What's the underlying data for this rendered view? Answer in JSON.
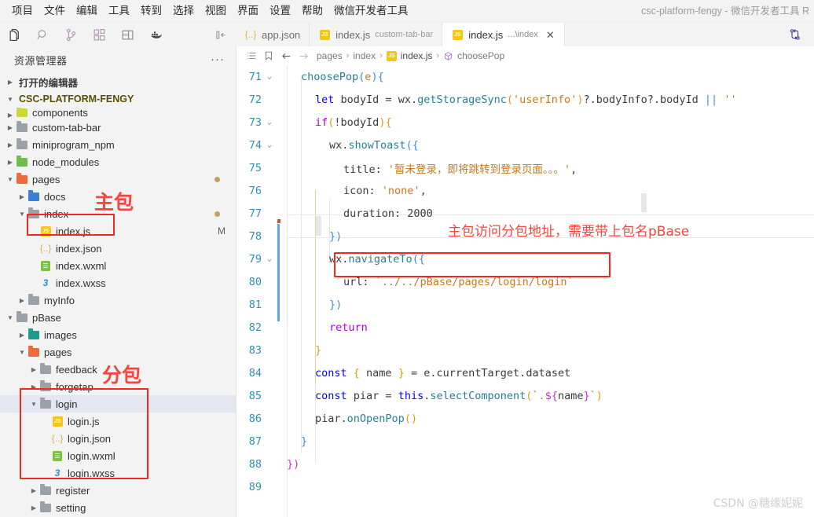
{
  "window": {
    "title": "csc-platform-fengy - 微信开发者工具 R",
    "menus": [
      "项目",
      "文件",
      "编辑",
      "工具",
      "转到",
      "选择",
      "视图",
      "界面",
      "设置",
      "帮助",
      "微信开发者工具"
    ]
  },
  "activity_bar": {
    "items": [
      {
        "name": "explorer-icon",
        "label": "资源管理器"
      },
      {
        "name": "search-icon",
        "label": "搜索"
      },
      {
        "name": "source-control-icon",
        "label": "源代码管理"
      },
      {
        "name": "extensions-icon",
        "label": "扩展"
      },
      {
        "name": "layout-icon",
        "label": "布局"
      },
      {
        "name": "docker-icon",
        "label": "Docker"
      }
    ],
    "collapse_label": "折叠"
  },
  "tabs": [
    {
      "label": "app.json",
      "desc": "",
      "icon": "json",
      "active": false,
      "closable": false
    },
    {
      "label": "index.js",
      "desc": "custom-tab-bar",
      "icon": "js",
      "active": false,
      "closable": false
    },
    {
      "label": "index.js",
      "desc": "...\\index",
      "icon": "js",
      "active": true,
      "closable": true
    }
  ],
  "tab_close_glyph": "✕",
  "sidebar": {
    "title": "资源管理器",
    "more_glyph": "···",
    "open_editors_label": "打开的编辑器",
    "project_label": "CSC-PLATFORM-FENGY",
    "tree": [
      {
        "label": "components",
        "indent": 1,
        "icon": "folder-yellow",
        "arrow": "right",
        "clipped": true
      },
      {
        "label": "custom-tab-bar",
        "indent": 1,
        "icon": "folder-gray",
        "arrow": "right"
      },
      {
        "label": "miniprogram_npm",
        "indent": 1,
        "icon": "folder-gray",
        "arrow": "right"
      },
      {
        "label": "node_modules",
        "indent": 1,
        "icon": "folder-green",
        "arrow": "right"
      },
      {
        "label": "pages",
        "indent": 1,
        "icon": "folder-red",
        "arrow": "down",
        "dot": true
      },
      {
        "label": "docs",
        "indent": 2,
        "icon": "folder-blue",
        "arrow": "right"
      },
      {
        "label": "index",
        "indent": 2,
        "icon": "folder-gray",
        "arrow": "down",
        "dot": true
      },
      {
        "label": "index.js",
        "indent": 3,
        "icon": "js",
        "arrow": "none",
        "mark": "M"
      },
      {
        "label": "index.json",
        "indent": 3,
        "icon": "json",
        "arrow": "none"
      },
      {
        "label": "index.wxml",
        "indent": 3,
        "icon": "wxml",
        "arrow": "none"
      },
      {
        "label": "index.wxss",
        "indent": 3,
        "icon": "wxss",
        "arrow": "none"
      },
      {
        "label": "myInfo",
        "indent": 2,
        "icon": "folder-gray",
        "arrow": "right"
      },
      {
        "label": "pBase",
        "indent": 1,
        "icon": "folder-gray",
        "arrow": "down"
      },
      {
        "label": "images",
        "indent": 2,
        "icon": "folder-teal",
        "arrow": "right"
      },
      {
        "label": "pages",
        "indent": 2,
        "icon": "folder-red",
        "arrow": "down"
      },
      {
        "label": "feedback",
        "indent": 3,
        "icon": "folder-gray",
        "arrow": "right"
      },
      {
        "label": "forgetap",
        "indent": 3,
        "icon": "folder-gray",
        "arrow": "right"
      },
      {
        "label": "login",
        "indent": 3,
        "icon": "folder-gray",
        "arrow": "down",
        "selected": true
      },
      {
        "label": "login.js",
        "indent": 4,
        "icon": "js",
        "arrow": "none"
      },
      {
        "label": "login.json",
        "indent": 4,
        "icon": "json",
        "arrow": "none"
      },
      {
        "label": "login.wxml",
        "indent": 4,
        "icon": "wxml",
        "arrow": "none"
      },
      {
        "label": "login.wxss",
        "indent": 4,
        "icon": "wxss",
        "arrow": "none"
      },
      {
        "label": "register",
        "indent": 3,
        "icon": "folder-gray",
        "arrow": "right"
      },
      {
        "label": "setting",
        "indent": 3,
        "icon": "folder-gray",
        "arrow": "right"
      }
    ]
  },
  "breadcrumb": {
    "items": [
      "pages",
      "index",
      "index.js",
      "choosePop"
    ],
    "separator": "›",
    "file_index": 2,
    "symbol_index": 3
  },
  "code": {
    "first_line": 71,
    "lines": [
      {
        "no": 71,
        "fold": "down",
        "indent": 0,
        "tokens": [
          {
            "t": "choosePop",
            "c": "prop"
          },
          {
            "t": "(",
            "c": "br1"
          },
          {
            "t": "e",
            "c": "cn"
          },
          {
            "t": ")",
            "c": "br1"
          },
          {
            "t": "{",
            "c": "br1"
          }
        ]
      },
      {
        "no": 72,
        "fold": "",
        "indent": 1,
        "tokens": [
          {
            "t": "let",
            "c": "kw"
          },
          {
            "t": " bodyId ",
            "c": "plain"
          },
          {
            "t": "=",
            "c": "plain"
          },
          {
            "t": " wx",
            "c": "plain"
          },
          {
            "t": ".",
            "c": "plain"
          },
          {
            "t": "getStorageSync",
            "c": "prop"
          },
          {
            "t": "(",
            "c": "br2"
          },
          {
            "t": "'userInfo'",
            "c": "strq"
          },
          {
            "t": ")",
            "c": "br2"
          },
          {
            "t": "?.",
            "c": "plain"
          },
          {
            "t": "bodyInfo",
            "c": "plain"
          },
          {
            "t": "?.",
            "c": "plain"
          },
          {
            "t": "bodyId ",
            "c": "plain"
          },
          {
            "t": "||",
            "c": "br1"
          },
          {
            "t": " ",
            "c": "plain"
          },
          {
            "t": "''",
            "c": "strq"
          }
        ]
      },
      {
        "no": 73,
        "fold": "down",
        "indent": 1,
        "tokens": [
          {
            "t": "if",
            "c": "kw2"
          },
          {
            "t": "(",
            "c": "br2"
          },
          {
            "t": "!",
            "c": "plain"
          },
          {
            "t": "bodyId",
            "c": "plain"
          },
          {
            "t": ")",
            "c": "br2"
          },
          {
            "t": "{",
            "c": "br2"
          }
        ]
      },
      {
        "no": 74,
        "fold": "down",
        "indent": 2,
        "tokens": [
          {
            "t": "wx",
            "c": "plain"
          },
          {
            "t": ".",
            "c": "plain"
          },
          {
            "t": "showToast",
            "c": "prop"
          },
          {
            "t": "(",
            "c": "br1"
          },
          {
            "t": "{",
            "c": "br1"
          }
        ]
      },
      {
        "no": 75,
        "fold": "",
        "indent": 3,
        "tokens": [
          {
            "t": "title",
            "c": "plain"
          },
          {
            "t": ": ",
            "c": "plain"
          },
          {
            "t": "'暂未登录，即将跳转到登录页面。。。'",
            "c": "strq"
          },
          {
            "t": ",",
            "c": "plain"
          }
        ]
      },
      {
        "no": 76,
        "fold": "",
        "indent": 3,
        "tokens": [
          {
            "t": "icon",
            "c": "plain"
          },
          {
            "t": ": ",
            "c": "plain"
          },
          {
            "t": "'none'",
            "c": "strq"
          },
          {
            "t": ",",
            "c": "plain"
          }
        ]
      },
      {
        "no": 77,
        "fold": "",
        "indent": 3,
        "tokens": [
          {
            "t": "duration",
            "c": "plain"
          },
          {
            "t": ": ",
            "c": "plain"
          },
          {
            "t": "2000",
            "c": "plain"
          }
        ]
      },
      {
        "no": 78,
        "fold": "",
        "indent": 2,
        "tokens": [
          {
            "t": "}",
            "c": "br1"
          },
          {
            "t": ")",
            "c": "br1"
          }
        ]
      },
      {
        "no": 79,
        "fold": "down",
        "indent": 2,
        "tokens": [
          {
            "t": "wx",
            "c": "plain"
          },
          {
            "t": ".",
            "c": "plain"
          },
          {
            "t": "navigateTo",
            "c": "prop"
          },
          {
            "t": "(",
            "c": "br1"
          },
          {
            "t": "{",
            "c": "br1"
          }
        ]
      },
      {
        "no": 80,
        "fold": "",
        "indent": 3,
        "tokens": [
          {
            "t": "url",
            "c": "plain"
          },
          {
            "t": ": ",
            "c": "plain"
          },
          {
            "t": "`../../pBase/pages/login/login`",
            "c": "strq"
          }
        ]
      },
      {
        "no": 81,
        "fold": "",
        "indent": 2,
        "tokens": [
          {
            "t": "}",
            "c": "br1"
          },
          {
            "t": ")",
            "c": "br1"
          }
        ]
      },
      {
        "no": 82,
        "fold": "",
        "indent": 2,
        "tokens": [
          {
            "t": "return",
            "c": "kw2"
          }
        ]
      },
      {
        "no": 83,
        "fold": "",
        "indent": 1,
        "tokens": [
          {
            "t": "}",
            "c": "br2"
          }
        ]
      },
      {
        "no": 84,
        "fold": "",
        "indent": 1,
        "tokens": [
          {
            "t": "const",
            "c": "kw"
          },
          {
            "t": " ",
            "c": "plain"
          },
          {
            "t": "{",
            "c": "br2"
          },
          {
            "t": " name ",
            "c": "plain"
          },
          {
            "t": "}",
            "c": "br2"
          },
          {
            "t": " = e",
            "c": "plain"
          },
          {
            "t": ".",
            "c": "plain"
          },
          {
            "t": "currentTarget",
            "c": "plain"
          },
          {
            "t": ".",
            "c": "plain"
          },
          {
            "t": "dataset",
            "c": "plain"
          }
        ]
      },
      {
        "no": 85,
        "fold": "",
        "indent": 1,
        "tokens": [
          {
            "t": "const",
            "c": "kw"
          },
          {
            "t": " piar ",
            "c": "plain"
          },
          {
            "t": "=",
            "c": "plain"
          },
          {
            "t": " ",
            "c": "plain"
          },
          {
            "t": "this",
            "c": "kw"
          },
          {
            "t": ".",
            "c": "plain"
          },
          {
            "t": "selectComponent",
            "c": "prop"
          },
          {
            "t": "(",
            "c": "br2"
          },
          {
            "t": "`.",
            "c": "strq"
          },
          {
            "t": "${",
            "c": "br3"
          },
          {
            "t": "name",
            "c": "plain"
          },
          {
            "t": "}",
            "c": "br3"
          },
          {
            "t": "`",
            "c": "strq"
          },
          {
            "t": ")",
            "c": "br2"
          }
        ]
      },
      {
        "no": 86,
        "fold": "",
        "indent": 1,
        "tokens": [
          {
            "t": "piar",
            "c": "plain"
          },
          {
            "t": ".",
            "c": "plain"
          },
          {
            "t": "onOpenPop",
            "c": "prop"
          },
          {
            "t": "(",
            "c": "br2"
          },
          {
            "t": ")",
            "c": "br2"
          }
        ]
      },
      {
        "no": 87,
        "fold": "",
        "indent": 0,
        "tokens": [
          {
            "t": "}",
            "c": "br1"
          }
        ]
      },
      {
        "no": 88,
        "fold": "",
        "indent": -1,
        "tokens": [
          {
            "t": "}",
            "c": "br3"
          },
          {
            "t": ")",
            "c": "br3"
          }
        ]
      },
      {
        "no": 89,
        "fold": "",
        "indent": -1,
        "tokens": []
      }
    ]
  },
  "annotations": {
    "main_package_label": "主包",
    "sub_package_label": "分包",
    "code_note": "主包访问分包地址，需要带上包名pBase"
  },
  "watermark": "CSDN @糖缘妮妮"
}
